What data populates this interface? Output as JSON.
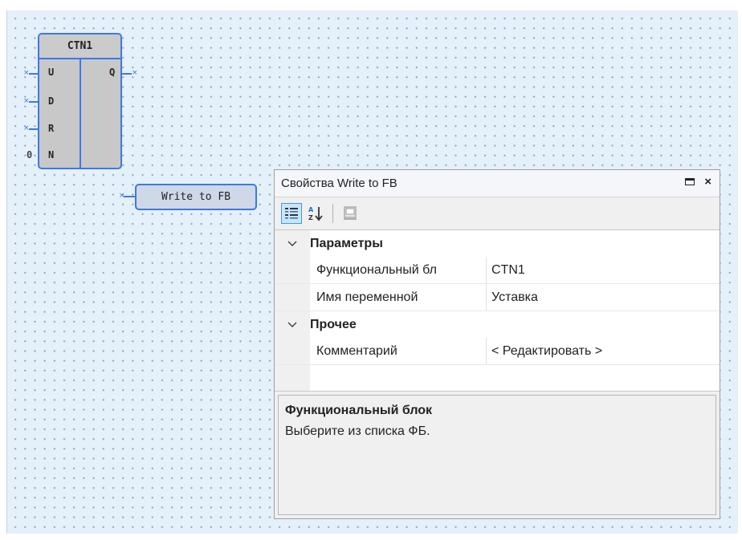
{
  "diagram": {
    "fb_block": {
      "title": "CTN1",
      "inputs": [
        "U",
        "D",
        "R",
        "N"
      ],
      "outputs": [
        "Q"
      ],
      "n_const": "0"
    },
    "write_block": {
      "label": "Write to FB"
    }
  },
  "panel": {
    "title": "Свойства Write to FB",
    "toolbar": {
      "categorized_icon": "categorized-icon",
      "alphabetical_icon": "sort-az-icon",
      "property_pages_icon": "property-pages-icon"
    },
    "categories": [
      {
        "label": "Параметры",
        "props": [
          {
            "name": "Функциональный бл",
            "value": "CTN1"
          },
          {
            "name": "Имя переменной",
            "value": "Уставка"
          }
        ]
      },
      {
        "label": "Прочее",
        "props": [
          {
            "name": "Комментарий",
            "value": "< Редактировать >"
          }
        ]
      }
    ],
    "description": {
      "title": "Функциональный блок",
      "text": "Выберите из списка ФБ."
    }
  },
  "colors": {
    "accent": "#3d78e6",
    "canvas": "#e4f0fa",
    "block_fill": "#c8c8c8"
  }
}
